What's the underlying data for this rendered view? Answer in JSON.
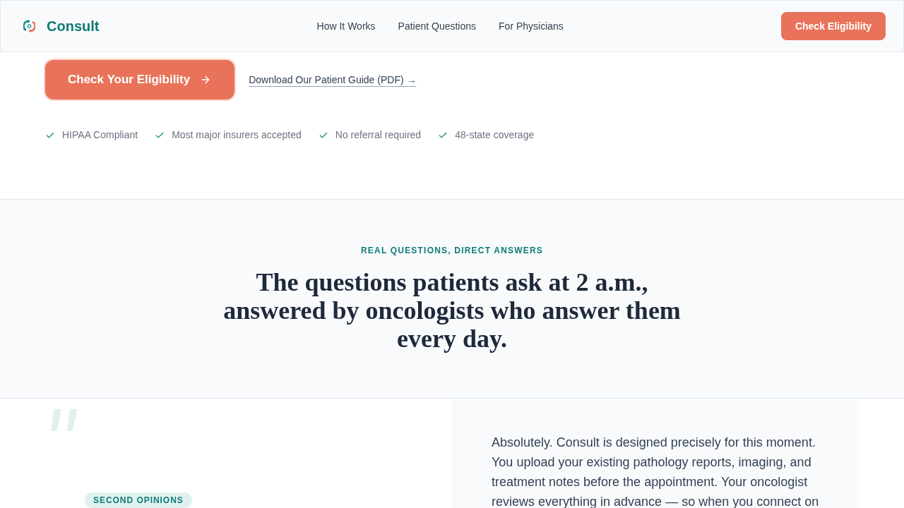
{
  "header": {
    "brand": "Consult",
    "nav": [
      {
        "label": "How It Works"
      },
      {
        "label": "Patient Questions"
      },
      {
        "label": "For Physicians"
      }
    ],
    "cta": "Check Eligibility"
  },
  "hero": {
    "primary_button": "Check Your Eligibility",
    "guide_link": "Download Our Patient Guide (PDF) →",
    "trust_items": [
      "HIPAA Compliant",
      "Most major insurers accepted",
      "No referral required",
      "48-state coverage"
    ]
  },
  "questions_section": {
    "eyebrow": "REAL QUESTIONS, DIRECT ANSWERS",
    "heading": "The questions patients ask at 2 a.m., answered by oncologists who answer them every day."
  },
  "featured_question": {
    "tag": "SECOND OPINIONS",
    "answer": "Absolutely. Consult is designed precisely for this moment. You upload your existing pathology reports, imaging, and treatment notes before the appointment. Your oncologist reviews everything in advance — so when you connect on"
  }
}
